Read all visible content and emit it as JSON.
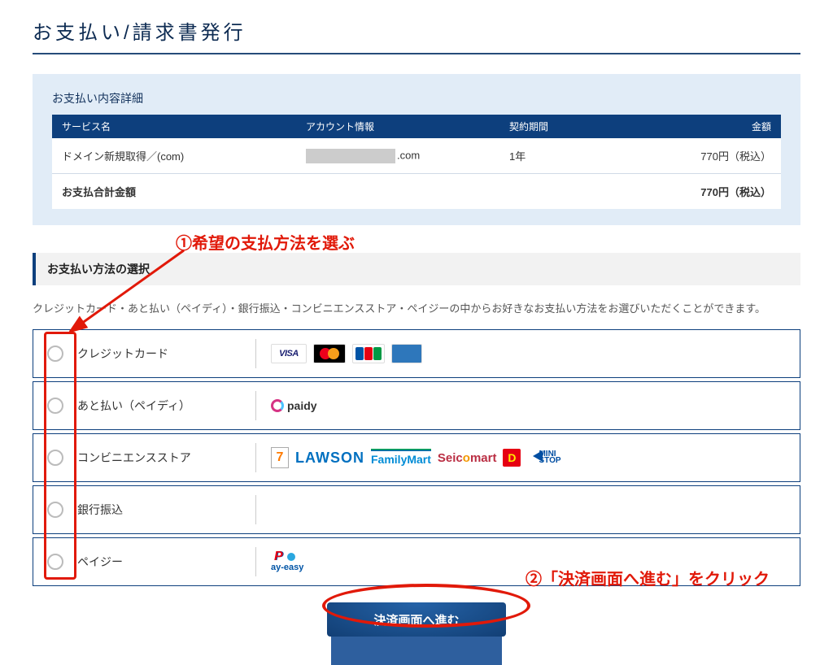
{
  "page": {
    "title": "お支払い/請求書発行"
  },
  "details": {
    "heading": "お支払い内容詳細",
    "columns": {
      "service": "サービス名",
      "account": "アカウント情報",
      "term": "契約期間",
      "amount": "金額"
    },
    "rows": [
      {
        "service": "ドメイン新規取得／(com)",
        "account_suffix": ".com",
        "term": "1年",
        "amount": "770円（税込）"
      }
    ],
    "total_label": "お支払合計金額",
    "total_amount": "770円（税込）"
  },
  "method": {
    "heading": "お支払い方法の選択",
    "description": "クレジットカード・あと払い（ペイディ）・銀行振込・コンビニエンスストア・ペイジーの中からお好きなお支払い方法をお選びいただくことができます。",
    "options": [
      {
        "key": "credit",
        "label": "クレジットカード"
      },
      {
        "key": "paidy",
        "label": "あと払い（ペイディ）"
      },
      {
        "key": "conbini",
        "label": "コンビニエンスストア"
      },
      {
        "key": "bank",
        "label": "銀行振込"
      },
      {
        "key": "payeasy",
        "label": "ペイジー"
      }
    ]
  },
  "submit": {
    "label": "決済画面へ進む"
  },
  "annotations": {
    "step1": "①希望の支払方法を選ぶ",
    "step2": "②「決済画面へ進む」をクリック"
  },
  "logos": {
    "visa": "VISA",
    "paidy": "paidy",
    "lawson": "LAWSON",
    "familymart": "FamilyMart",
    "seico_1": "Seic",
    "seico_o": "o",
    "seico_2": "mart",
    "daily": "D",
    "mini1": "MINI",
    "mini2": "STOP",
    "payeasy": "ay-easy"
  }
}
